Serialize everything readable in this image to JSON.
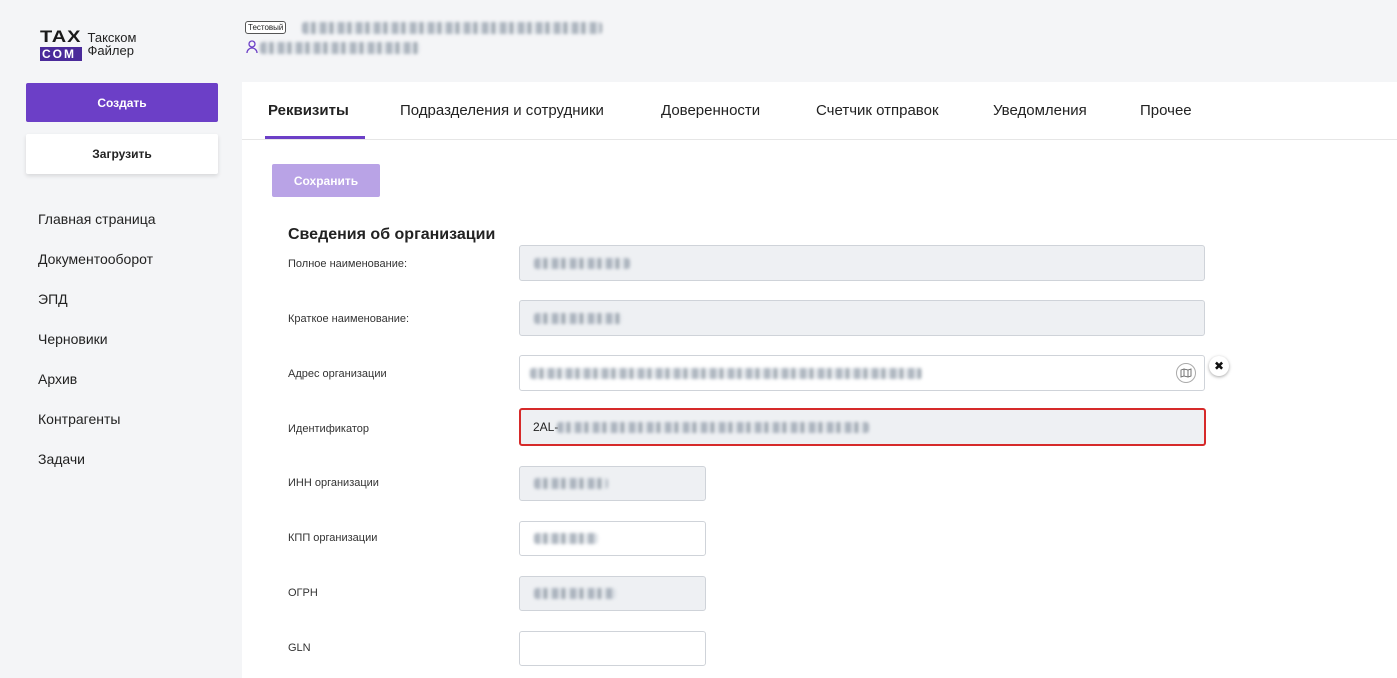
{
  "logo": {
    "line1": "TAX",
    "line2": "COM",
    "name1": "Такском",
    "name2": "Файлер"
  },
  "sidebar": {
    "create_label": "Создать",
    "upload_label": "Загрузить",
    "items": [
      {
        "label": "Главная страница"
      },
      {
        "label": "Документооборот"
      },
      {
        "label": "ЭПД"
      },
      {
        "label": "Черновики"
      },
      {
        "label": "Архив"
      },
      {
        "label": "Контрагенты"
      },
      {
        "label": "Задачи"
      }
    ]
  },
  "header": {
    "badge": "Тестовый"
  },
  "tabs": [
    {
      "label": "Реквизиты",
      "active": true
    },
    {
      "label": "Подразделения и сотрудники"
    },
    {
      "label": "Доверенности"
    },
    {
      "label": "Счетчик отправок"
    },
    {
      "label": "Уведомления"
    },
    {
      "label": "Прочее"
    }
  ],
  "form": {
    "save_label": "Сохранить",
    "section_title": "Сведения об организации",
    "fields": {
      "full_name": {
        "label": "Полное наименование:"
      },
      "short_name": {
        "label": "Краткое наименование:"
      },
      "address": {
        "label": "Адрес организации"
      },
      "identifier": {
        "label": "Идентификатор",
        "value_prefix": "2AL-"
      },
      "inn": {
        "label": "ИНН организации"
      },
      "kpp": {
        "label": "КПП организации"
      },
      "ogrn": {
        "label": "ОГРН"
      },
      "gln": {
        "label": "GLN",
        "value": ""
      }
    }
  },
  "colors": {
    "accent": "#6c3fc7",
    "accent_disabled": "#b9a3e6",
    "error": "#d62a2a"
  },
  "icons": {
    "map": "map-icon",
    "clear": "close-icon",
    "user": "user-icon"
  }
}
